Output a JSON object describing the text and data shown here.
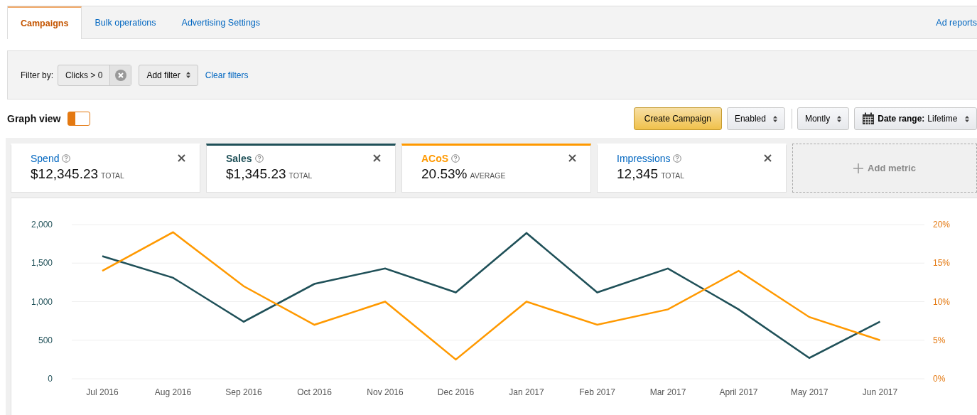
{
  "tabs": [
    {
      "label": "Campaigns",
      "selected": true
    },
    {
      "label": "Bulk operations",
      "selected": false
    },
    {
      "label": "Advertising Settings",
      "selected": false
    }
  ],
  "tab_link": "Ad reports",
  "filter": {
    "label": "Filter by:",
    "chips": [
      "Clicks > 0"
    ],
    "add_filter": "Add filter",
    "clear": "Clear filters"
  },
  "graph_view": {
    "label": "Graph view",
    "on": true
  },
  "toolbar": {
    "create": "Create Campaign",
    "status": "Enabled",
    "interval": "Montly",
    "date_label": "Date range:",
    "date_value": "Lifetime"
  },
  "metrics": [
    {
      "label": "Spend",
      "value": "$12,345.23",
      "unit": "TOTAL",
      "selected": false
    },
    {
      "label": "Sales",
      "value": "$1,345.23",
      "unit": "TOTAL",
      "selected": true,
      "color": "#1f5058"
    },
    {
      "label": "ACoS",
      "value": "20.53%",
      "unit": "AVERAGE",
      "selected": true,
      "color": "#ff9900"
    },
    {
      "label": "Impressions",
      "value": "12,345",
      "unit": "TOTAL",
      "selected": false
    }
  ],
  "add_metric": "Add metric",
  "chart_data": {
    "type": "line",
    "categories": [
      "Jul 2016",
      "Aug 2016",
      "Sep 2016",
      "Oct 2016",
      "Nov 2016",
      "Dec 2016",
      "Jan 2017",
      "Feb 2017",
      "Mar 2017",
      "April 2017",
      "May 2017",
      "Jun 2017"
    ],
    "grid": true,
    "ylim": [
      0,
      2000
    ],
    "yticks": [
      {
        "value": 0,
        "label": "0"
      },
      {
        "value": 500,
        "label": "500"
      },
      {
        "value": 1000,
        "label": "1,000"
      },
      {
        "value": 1500,
        "label": "1,500"
      },
      {
        "value": 2000,
        "label": "2,000"
      }
    ],
    "y2lim": [
      0,
      20
    ],
    "y2ticks": [
      {
        "value": 0,
        "label": "0%"
      },
      {
        "value": 5,
        "label": "5%"
      },
      {
        "value": 10,
        "label": "10%"
      },
      {
        "value": 15,
        "label": "15%"
      },
      {
        "value": 20,
        "label": "20%"
      }
    ],
    "series": [
      {
        "color": "#1f5058",
        "values": [
          1590,
          1310,
          740,
          1230,
          1430,
          1120,
          1890,
          1120,
          1430,
          900,
          270,
          740
        ]
      },
      {
        "color": "#ff9900",
        "axis": "y2",
        "values": [
          14,
          19,
          12,
          7,
          10,
          2.5,
          10,
          7,
          9,
          14,
          8,
          5
        ]
      }
    ]
  }
}
